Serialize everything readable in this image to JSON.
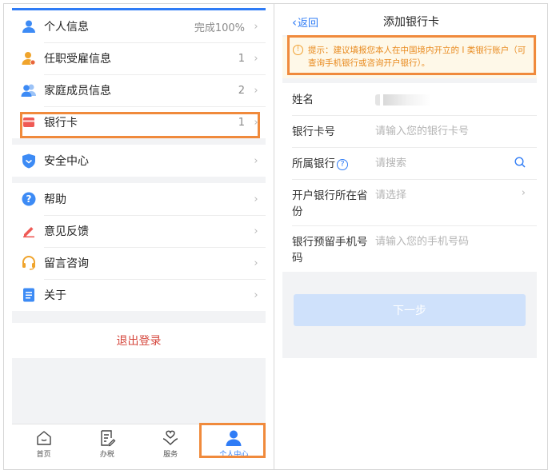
{
  "left": {
    "menu_group_1": [
      {
        "label": "个人信息",
        "value": "完成100%",
        "icon": "person-icon"
      },
      {
        "label": "任职受雇信息",
        "value": "1",
        "icon": "employment-icon"
      },
      {
        "label": "家庭成员信息",
        "value": "2",
        "icon": "family-icon"
      },
      {
        "label": "银行卡",
        "value": "1",
        "icon": "bank-card-icon"
      }
    ],
    "menu_group_2": [
      {
        "label": "安全中心",
        "value": "",
        "icon": "shield-icon"
      }
    ],
    "menu_group_3": [
      {
        "label": "帮助",
        "value": "",
        "icon": "help-icon"
      },
      {
        "label": "意见反馈",
        "value": "",
        "icon": "feedback-pen-icon"
      },
      {
        "label": "留言咨询",
        "value": "",
        "icon": "headset-icon"
      },
      {
        "label": "关于",
        "value": "",
        "icon": "document-icon"
      }
    ],
    "logout_label": "退出登录",
    "tabs": [
      {
        "label": "首页",
        "icon": "home-icon"
      },
      {
        "label": "办税",
        "icon": "tax-form-icon"
      },
      {
        "label": "服务",
        "icon": "heart-hands-icon"
      },
      {
        "label": "个人中心",
        "icon": "user-center-icon"
      }
    ]
  },
  "right": {
    "back_label": "返回",
    "title": "添加银行卡",
    "tip": "提示：建议填报您本人在中国境内开立的 I 类银行账户（可查询手机银行或咨询开户银行）。",
    "fields": [
      {
        "label": "姓名",
        "value": ""
      },
      {
        "label": "银行卡号",
        "placeholder": "请输入您的银行卡号"
      },
      {
        "label": "所属银行",
        "placeholder": "请搜索"
      },
      {
        "label": "开户银行所在省份",
        "placeholder": "请选择"
      },
      {
        "label": "银行预留手机号码",
        "placeholder": "请输入您的手机号码"
      }
    ],
    "next_label": "下一步"
  },
  "colors": {
    "accent": "#2f7cf6",
    "highlight": "#f08a3c",
    "logout": "#d5473d",
    "tip_text": "#e8891d",
    "tip_bg": "#fef8e8"
  }
}
